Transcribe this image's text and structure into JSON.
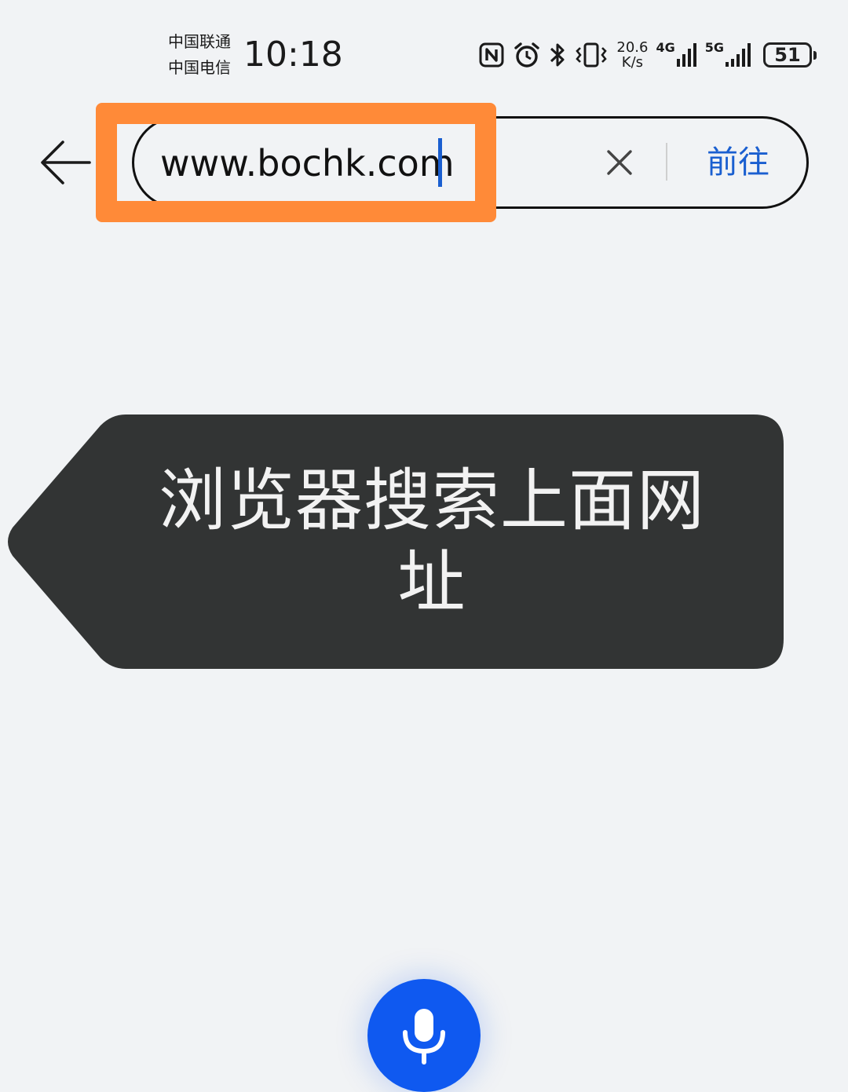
{
  "status_bar": {
    "carrier_1": "中国联通",
    "carrier_2": "中国电信",
    "time": "10:18",
    "net_speed_value": "20.6",
    "net_speed_unit": "K/s",
    "signal_1_label": "4G",
    "signal_2_label": "5G",
    "battery_level": "51",
    "icons": [
      "nfc-icon",
      "alarm-icon",
      "bluetooth-icon",
      "vibrate-icon"
    ]
  },
  "address_bar": {
    "url_value": "www.bochk.com",
    "go_label": "前往",
    "accent_color": "#1a5fd0"
  },
  "annotation": {
    "highlight_color": "#ff8a38",
    "callout_text": "浏览器搜索上面网址"
  },
  "voice": {
    "mic_color": "#0f59f0"
  }
}
